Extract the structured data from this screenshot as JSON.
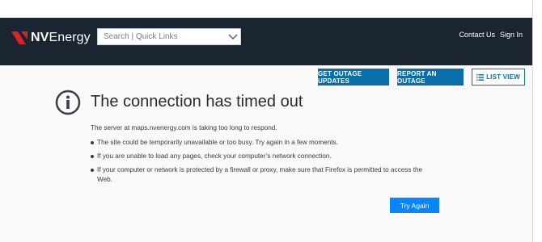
{
  "header": {
    "logo_text_bold": "NV",
    "logo_text_rest": "Energy",
    "search_placeholder": "Search | Quick Links",
    "contact_us": "Contact Us",
    "sign_in": "Sign In"
  },
  "actions": {
    "outage_updates": "GET OUTAGE UPDATES",
    "report_outage": "REPORT AN OUTAGE",
    "list_view": "LIST VIEW"
  },
  "error": {
    "title": "The connection has timed out",
    "description": "The server at maps.nvenergy.com is taking too long to respond.",
    "bullets": [
      "The site could be temporarily unavailable or too busy. Try again in a few moments.",
      "If you are unable to load any pages, check your computer’s network connection.",
      "If your computer or network is protected by a firewall or proxy, make sure that Firefox is permitted to access the Web."
    ],
    "try_again_label": "Try Again"
  },
  "colors": {
    "header_bg": "#1b2532",
    "brand_red": "#d8232a",
    "accent_blue": "#0a6ea9",
    "try_again_blue": "#0a84ff"
  },
  "icons": {
    "logo": "nv-energy-logo-mark",
    "search_dropdown": "chevron-down-icon",
    "list_view": "list-icon",
    "error": "info-icon"
  }
}
